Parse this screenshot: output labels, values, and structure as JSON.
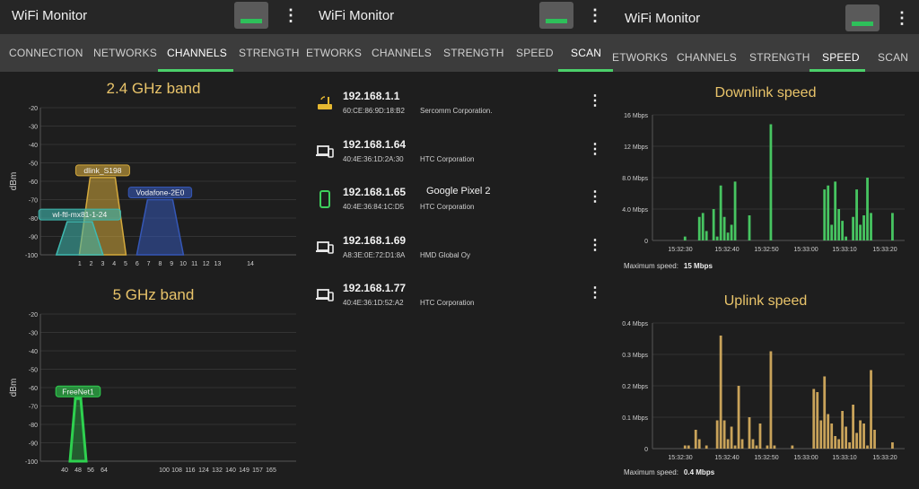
{
  "app_title": "WiFi Monitor",
  "colors": {
    "accent": "#4bd06a",
    "gold": "#e9c46a",
    "bar_green": "#47c561",
    "bar_gold": "#c9a35a"
  },
  "panel1": {
    "tabs": [
      "CONNECTION",
      "NETWORKS",
      "CHANNELS",
      "STRENGTH"
    ],
    "active_tab": "CHANNELS",
    "band24": {
      "title": "2.4 GHz band",
      "ylabel": "dBm",
      "yticks": [
        "-20",
        "-30",
        "-40",
        "-50",
        "-60",
        "-70",
        "-80",
        "-90",
        "-100"
      ],
      "xticks": [
        "1",
        "2",
        "3",
        "4",
        "5",
        "6",
        "7",
        "8",
        "9",
        "10",
        "11",
        "12",
        "13",
        "14"
      ],
      "networks": [
        {
          "name": "dlink_S198",
          "channel": 3,
          "dbm": -58,
          "color": "#d4a93c"
        },
        {
          "name": "Vodafone-2E0",
          "channel": 8,
          "dbm": -70,
          "color": "#3557b6"
        },
        {
          "name": "wl-ftl-mx81-1-24",
          "channel": 1,
          "dbm": -82,
          "color": "#3fb9b0"
        }
      ]
    },
    "band5": {
      "title": "5 GHz band",
      "ylabel": "dBm",
      "yticks": [
        "-20",
        "-30",
        "-40",
        "-50",
        "-60",
        "-70",
        "-80",
        "-90",
        "-100"
      ],
      "xticks": [
        "40",
        "48",
        "56",
        "64",
        "100",
        "108",
        "116",
        "124",
        "132",
        "140",
        "149",
        "157",
        "165"
      ],
      "networks": [
        {
          "name": "FreeNet1",
          "channel": 48,
          "dbm": -66,
          "color": "#2ed14f"
        }
      ]
    }
  },
  "panel2": {
    "tabs": [
      "ETWORKS",
      "CHANNELS",
      "STRENGTH",
      "SPEED",
      "SCAN"
    ],
    "active_tab": "SCAN",
    "devices": [
      {
        "ip": "192.168.1.1",
        "mac": "60:CE:86:9D:18:B2",
        "vendor": "Sercomm Corporation.",
        "name": "",
        "icon": "router-icon"
      },
      {
        "ip": "192.168.1.64",
        "mac": "40:4E:36:1D:2A:30",
        "vendor": "HTC Corporation",
        "name": "",
        "icon": "devices-icon"
      },
      {
        "ip": "192.168.1.65",
        "mac": "40:4E:36:84:1C:D5",
        "vendor": "HTC Corporation",
        "name": "Google Pixel 2",
        "icon": "phone-icon"
      },
      {
        "ip": "192.168.1.69",
        "mac": "A8:3E:0E:72:D1:8A",
        "vendor": "HMD Global Oy",
        "name": "",
        "icon": "devices-icon"
      },
      {
        "ip": "192.168.1.77",
        "mac": "40:4E:36:1D:52:A2",
        "vendor": "HTC Corporation",
        "name": "",
        "icon": "devices-icon"
      }
    ]
  },
  "panel3": {
    "tabs": [
      "ETWORKS",
      "CHANNELS",
      "STRENGTH",
      "SPEED",
      "SCAN"
    ],
    "active_tab": "SPEED",
    "max_label": "Maximum speed:",
    "chart_data": [
      {
        "type": "bar",
        "title": "Downlink speed",
        "unit": "Mbps",
        "yticks": [
          "16 Mbps",
          "12 Mbps",
          "8.0 Mbps",
          "4.0 Mbps",
          "0"
        ],
        "ylim": [
          0,
          16
        ],
        "xticks": [
          "15:32:30",
          "15:32:40",
          "15:32:50",
          "15:33:00",
          "15:33:10",
          "15:33:20"
        ],
        "max_speed": "15 Mbps",
        "values": [
          0,
          0,
          0,
          0,
          0,
          0,
          0,
          0,
          0.5,
          0,
          0,
          0,
          3,
          3.5,
          1.2,
          0,
          4,
          0.5,
          7,
          3,
          1,
          2,
          7.5,
          0,
          0,
          0,
          3.2,
          0,
          0,
          0,
          0,
          0,
          14.8,
          0,
          0,
          0,
          0,
          0,
          0,
          0,
          0,
          0,
          0,
          0,
          0,
          0,
          0,
          6.5,
          7,
          2,
          7.5,
          4,
          2.5,
          0.5,
          0,
          3,
          6.5,
          2,
          3.2,
          8,
          3.5,
          0,
          0,
          0,
          0,
          0,
          3.5,
          0,
          0
        ]
      },
      {
        "type": "bar",
        "title": "Uplink speed",
        "unit": "Mbps",
        "yticks": [
          "0.4 Mbps",
          "0.3 Mbps",
          "0.2 Mbps",
          "0.1 Mbps",
          "0"
        ],
        "ylim": [
          0,
          0.4
        ],
        "xticks": [
          "15:32:30",
          "15:32:40",
          "15:32:50",
          "15:33:00",
          "15:33:10",
          "15:33:20"
        ],
        "max_speed": "0.4 Mbps",
        "values": [
          0,
          0,
          0,
          0,
          0,
          0,
          0,
          0,
          0.01,
          0.01,
          0,
          0.06,
          0.03,
          0,
          0.01,
          0,
          0,
          0.09,
          0.36,
          0.09,
          0.03,
          0.07,
          0.01,
          0.2,
          0.03,
          0,
          0.1,
          0.03,
          0.01,
          0.08,
          0,
          0.01,
          0.31,
          0.01,
          0,
          0,
          0,
          0,
          0.01,
          0,
          0,
          0,
          0,
          0,
          0.19,
          0.18,
          0.09,
          0.23,
          0.11,
          0.08,
          0.04,
          0.03,
          0.12,
          0.07,
          0.02,
          0.14,
          0.05,
          0.09,
          0.08,
          0.01,
          0.25,
          0.06,
          0,
          0,
          0,
          0,
          0.02,
          0,
          0
        ]
      }
    ]
  }
}
